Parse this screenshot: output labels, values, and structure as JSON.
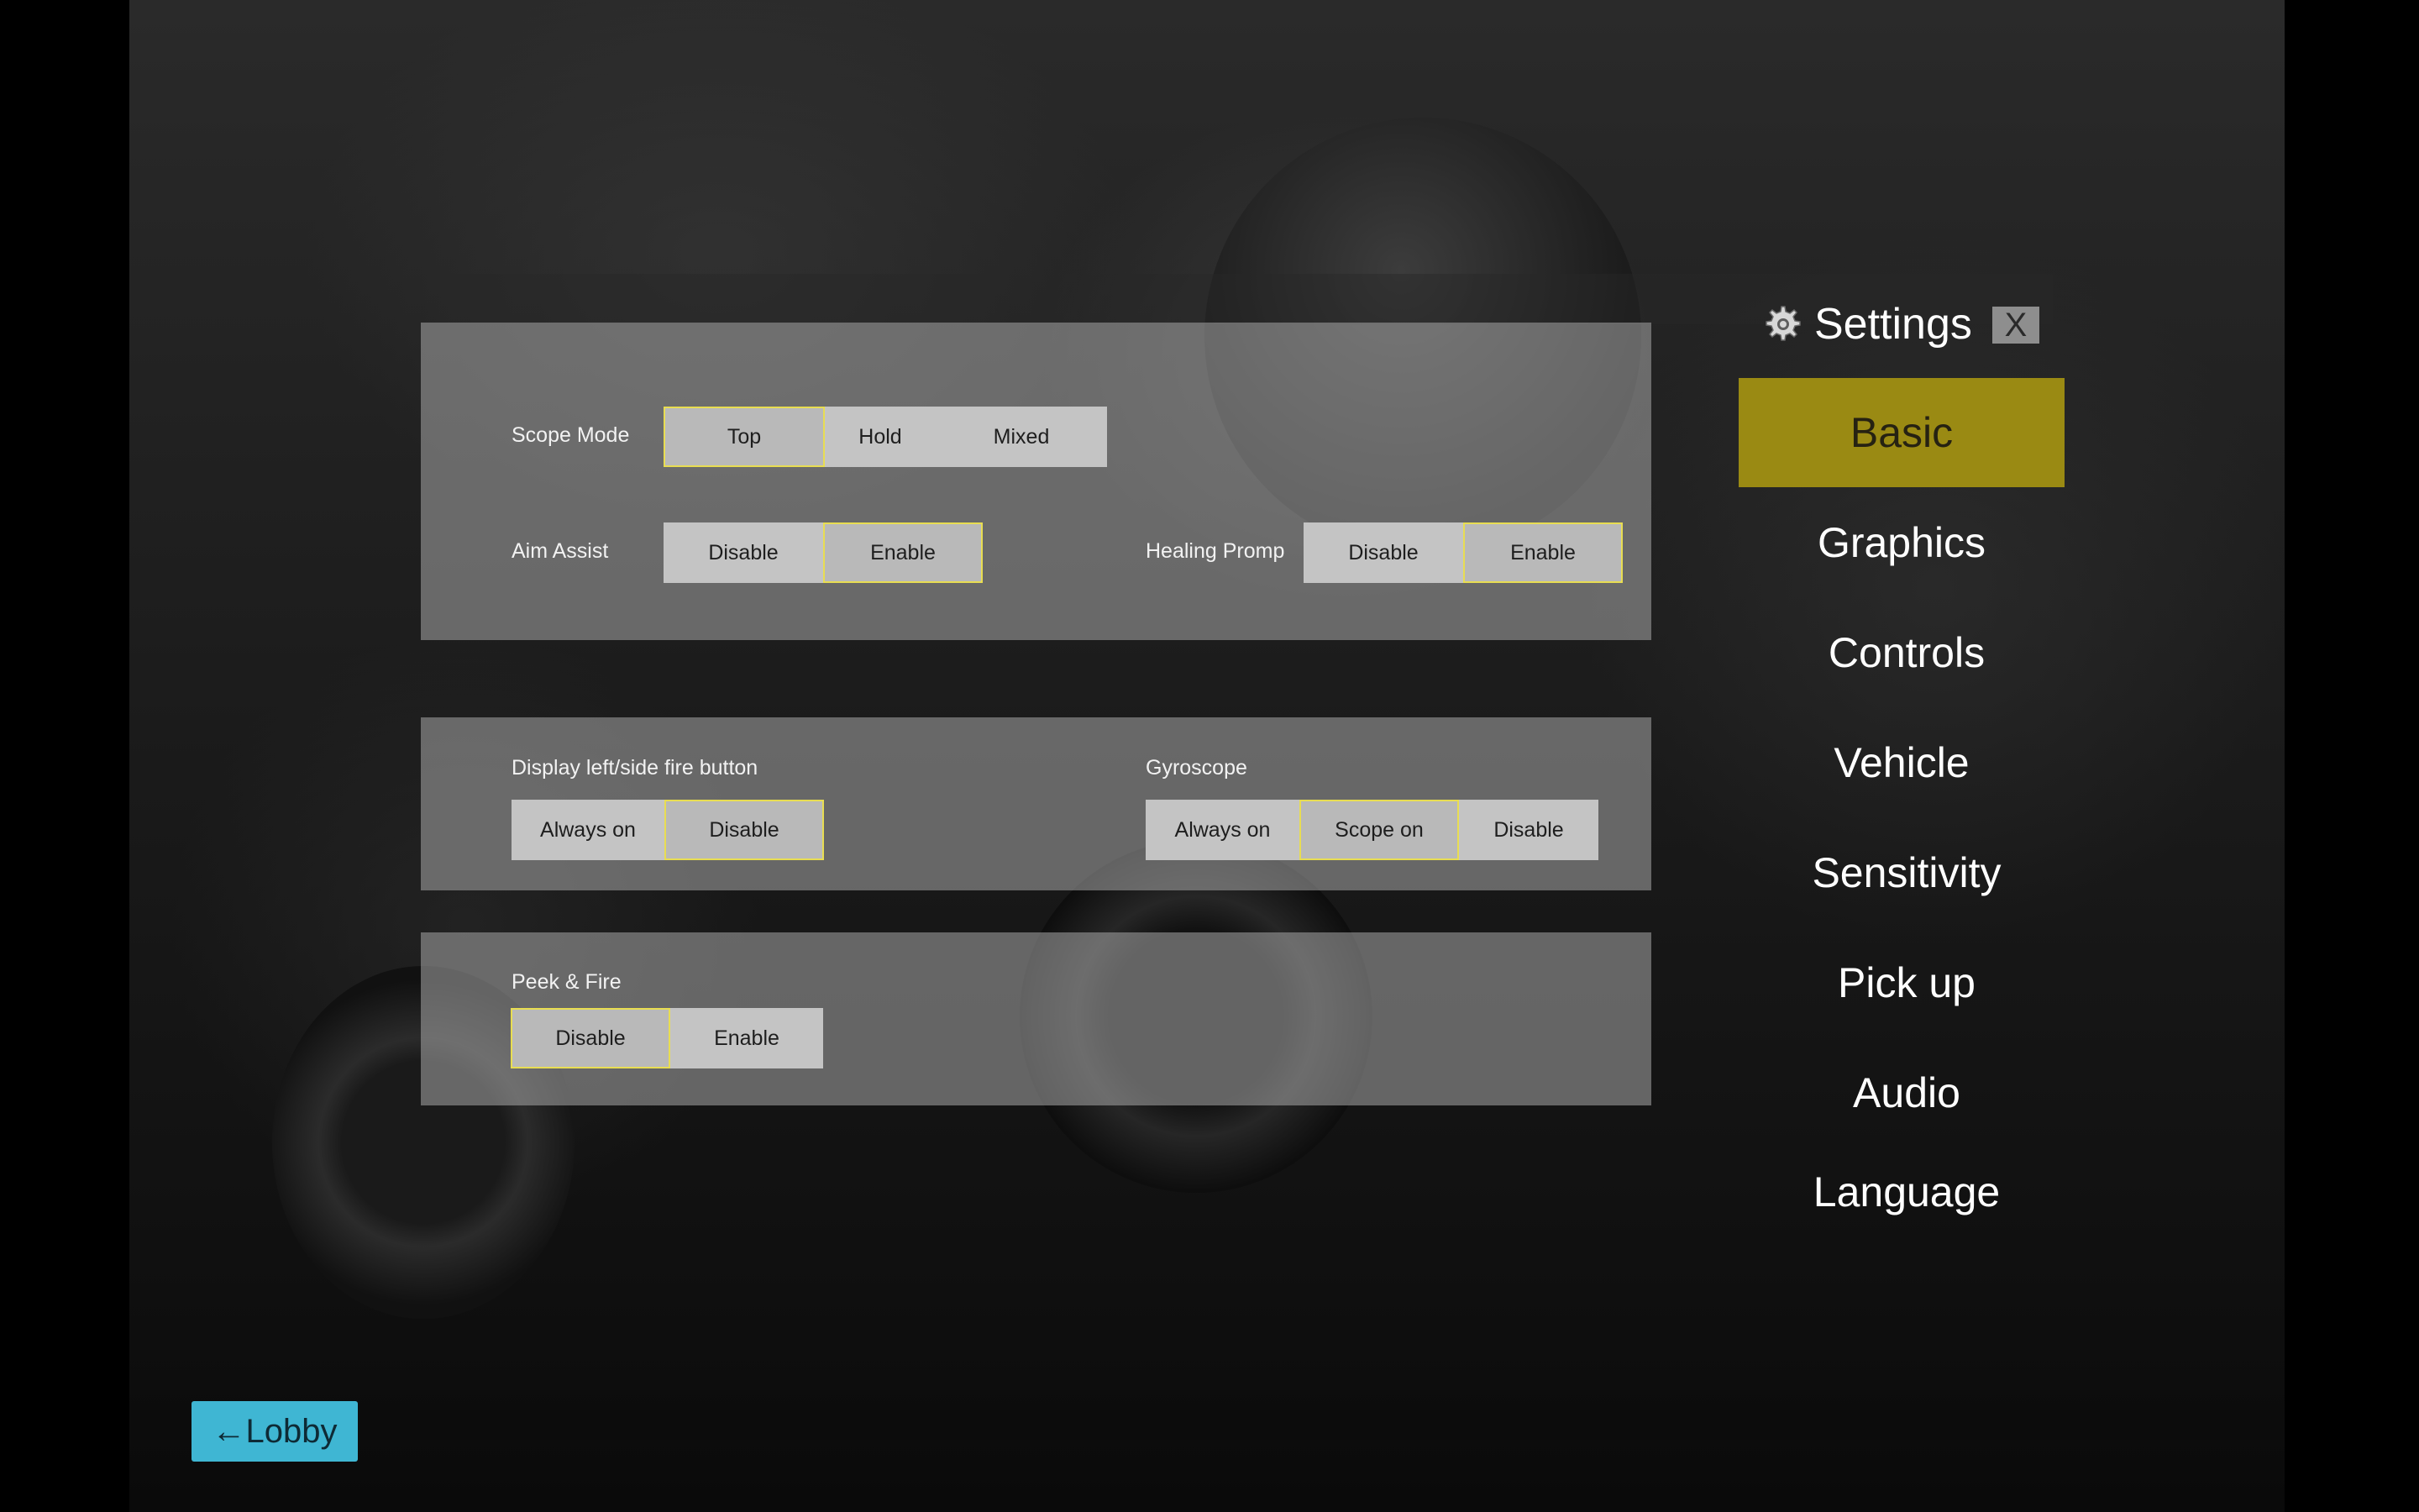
{
  "sidebar": {
    "title": "Settings",
    "close_label": "X",
    "gear_icon": "gear-icon",
    "items": [
      {
        "label": "Basic",
        "active": true
      },
      {
        "label": "Graphics"
      },
      {
        "label": "Controls"
      },
      {
        "label": "Vehicle"
      },
      {
        "label": "Sensitivity"
      },
      {
        "label": "Pick up"
      },
      {
        "label": "Audio"
      },
      {
        "label": "Language"
      }
    ]
  },
  "settings": {
    "scope_mode": {
      "label": "Scope Mode",
      "options": [
        "Top",
        "Hold",
        "Mixed"
      ],
      "selected": "Top"
    },
    "aim_assist": {
      "label": "Aim Assist",
      "options": [
        "Disable",
        "Enable"
      ],
      "selected": "Enable"
    },
    "healing_prompt": {
      "label": "Healing Promp",
      "options": [
        "Disable",
        "Enable"
      ],
      "selected": "Enable"
    },
    "fire_button": {
      "label": "Display left/side fire button",
      "options": [
        "Always on",
        "Disable"
      ],
      "selected": "Disable"
    },
    "gyroscope": {
      "label": "Gyroscope",
      "options": [
        "Always on",
        "Scope on",
        "Disable"
      ],
      "selected": "Scope on"
    },
    "peek_fire": {
      "label": "Peek & Fire",
      "options": [
        "Disable",
        "Enable"
      ],
      "selected": "Disable"
    }
  },
  "lobby_button": "←Lobby",
  "colors": {
    "accent_selected_border": "#e8dd52",
    "active_tab": "#9a8a13",
    "lobby_button": "#3fb6d3"
  }
}
